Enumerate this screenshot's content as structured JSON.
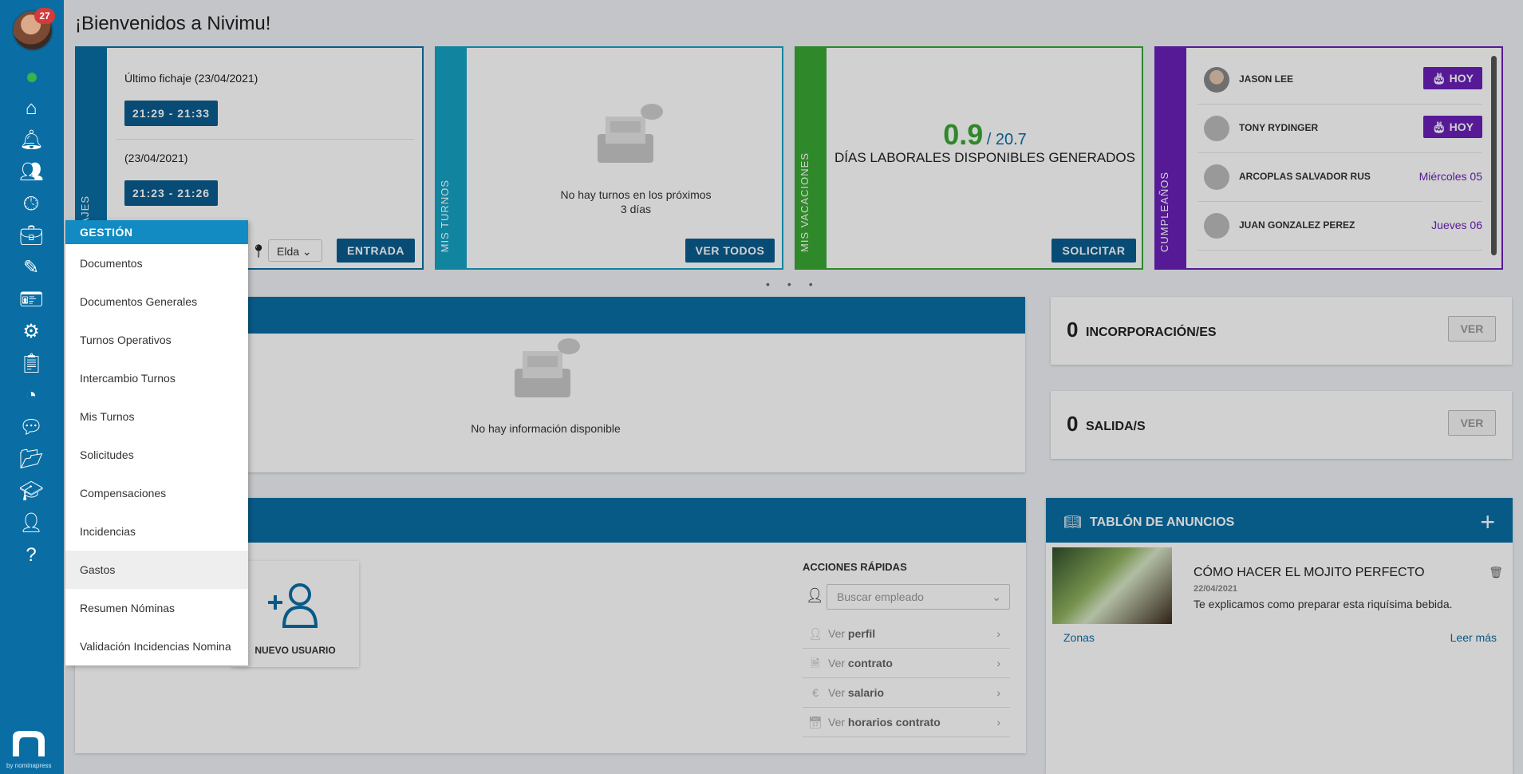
{
  "sidebar": {
    "notification_count": "27",
    "brand_text": "by nominapress",
    "icons": [
      "home-icon",
      "bell-icon",
      "users-icon",
      "clock-icon",
      "briefcase-icon",
      "tools-icon",
      "id-card-icon",
      "gear-icon",
      "clipboard-icon",
      "pie-chart-icon",
      "chat-icon",
      "folder-icon",
      "graduation-cap-icon",
      "user-money-icon",
      "help-icon"
    ]
  },
  "header": {
    "title": "¡Bienvenidos a Nivimu!"
  },
  "fichaje": {
    "strip_label": "FICHAJES",
    "last_label": "Último fichaje (23/04/2021)",
    "last_time": "21:29 - 21:33",
    "prev_label": "(23/04/2021)",
    "prev_time": "21:23 - 21:26",
    "location": "Elda",
    "entrada_label": "ENTRADA"
  },
  "turnos": {
    "strip_label": "MIS TURNOS",
    "empty_line1": "No hay turnos en los próximos",
    "empty_line2": "3 días",
    "button": "VER TODOS"
  },
  "vacaciones": {
    "strip_label": "MIS VACACIONES",
    "available": "0.9",
    "total": "/ 20.7",
    "caption": "DÍAS LABORALES DISPONIBLES GENERADOS",
    "button": "SOLICITAR"
  },
  "cumpleanos": {
    "strip_label": "CUMPLEAÑOS",
    "rows": [
      {
        "name": "JASON LEE",
        "badge": "HOY"
      },
      {
        "name": "TONY RYDINGER",
        "badge": "HOY"
      },
      {
        "name": "ARCOPLAS SALVADOR RUS",
        "date": "Miércoles  05"
      },
      {
        "name": "JUAN GONZALEZ PEREZ",
        "date": "Jueves  06"
      }
    ]
  },
  "info_panel": {
    "empty": "No hay información disponible"
  },
  "incorporaciones": {
    "count": "0",
    "label": "INCORPORACIÓN/ES",
    "button": "VER"
  },
  "salidas": {
    "count": "0",
    "label": "SALIDA/S",
    "button": "VER"
  },
  "tablon": {
    "title": "TABLÓN DE ANUNCIOS",
    "post_title": "CÓMO HACER EL MOJITO PERFECTO",
    "post_date": "22/04/2021",
    "post_desc": "Te explicamos como preparar esta riquísima bebida.",
    "zonas": "Zonas",
    "more": "Leer más"
  },
  "usuarios": {
    "nuevo_label": "NUEVO USUARIO"
  },
  "acciones": {
    "title": "ACCIONES RÁPIDAS",
    "search_placeholder": "Buscar empleado",
    "items": [
      {
        "prefix": "Ver ",
        "bold": "perfil"
      },
      {
        "prefix": "Ver ",
        "bold": "contrato"
      },
      {
        "prefix": "Ver ",
        "bold": "salario"
      },
      {
        "prefix": "Ver ",
        "bold": "horarios contrato"
      }
    ]
  },
  "menu": {
    "header": "GESTIÓN",
    "items": [
      "Documentos",
      "Documentos Generales",
      "Turnos Operativos",
      "Intercambio Turnos",
      "Mis Turnos",
      "Solicitudes",
      "Compensaciones",
      "Incidencias",
      "Gastos",
      "Resumen Nóminas",
      "Validación Incidencias Nomina"
    ],
    "active": "Gastos"
  },
  "colors": {
    "primary": "#0a6ea4",
    "teal": "#15a1c4",
    "green": "#3aa634",
    "purple": "#6a20b9"
  }
}
